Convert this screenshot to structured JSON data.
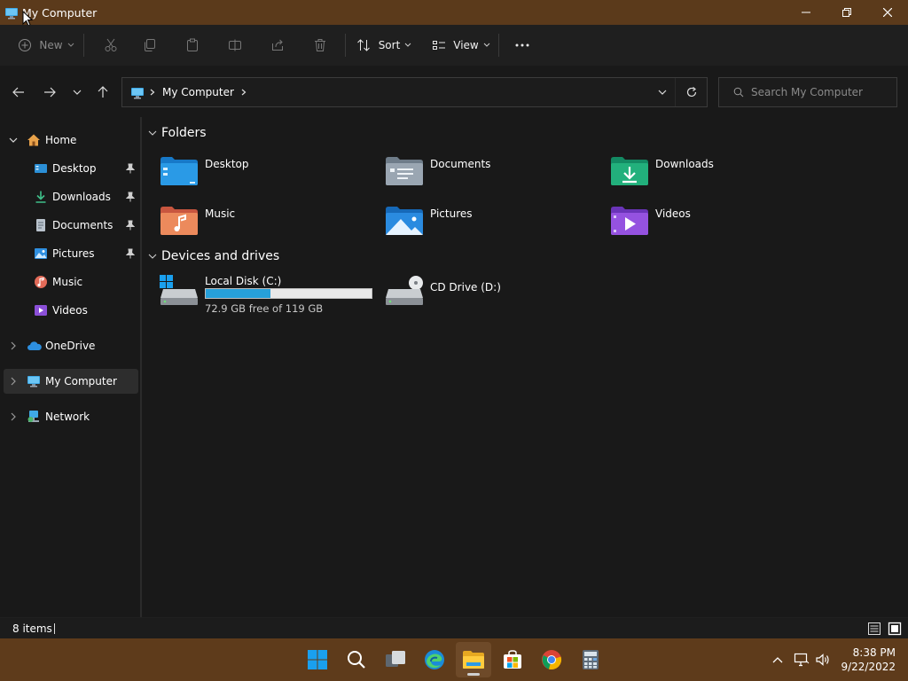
{
  "window": {
    "title": "My Computer"
  },
  "toolbar": {
    "new_label": "New",
    "sort_label": "Sort",
    "view_label": "View"
  },
  "address": {
    "crumb": "My Computer"
  },
  "search": {
    "placeholder": "Search My Computer"
  },
  "sidebar": {
    "items": [
      {
        "label": "Home"
      },
      {
        "label": "Desktop"
      },
      {
        "label": "Downloads"
      },
      {
        "label": "Documents"
      },
      {
        "label": "Pictures"
      },
      {
        "label": "Music"
      },
      {
        "label": "Videos"
      },
      {
        "label": "OneDrive"
      },
      {
        "label": "My Computer"
      },
      {
        "label": "Network"
      }
    ]
  },
  "content": {
    "folders_heading": "Folders",
    "folders": [
      {
        "label": "Desktop"
      },
      {
        "label": "Documents"
      },
      {
        "label": "Downloads"
      },
      {
        "label": "Music"
      },
      {
        "label": "Pictures"
      },
      {
        "label": "Videos"
      }
    ],
    "drives_heading": "Devices and drives",
    "drives": [
      {
        "label": "Local Disk (C:)",
        "free_text": "72.9 GB free of 119 GB",
        "used_fraction": 0.39
      },
      {
        "label": "CD Drive (D:)"
      }
    ]
  },
  "status": {
    "item_count": "8 items"
  },
  "clock": {
    "time": "8:38 PM",
    "date": "9/22/2022"
  },
  "colors": {
    "accent": "#26a0da",
    "titlebar": "#5b3a1b",
    "taskbar": "#5e3b1b"
  },
  "icons": [
    "computer-icon",
    "new-icon",
    "cut-icon",
    "copy-icon",
    "paste-icon",
    "rename-icon",
    "share-icon",
    "delete-icon",
    "sort-icon",
    "view-icon",
    "more-icon",
    "back-icon",
    "forward-icon",
    "recent-icon",
    "up-icon",
    "refresh-icon",
    "search-icon",
    "home-icon",
    "pin-icon",
    "onedrive-icon",
    "network-icon"
  ]
}
